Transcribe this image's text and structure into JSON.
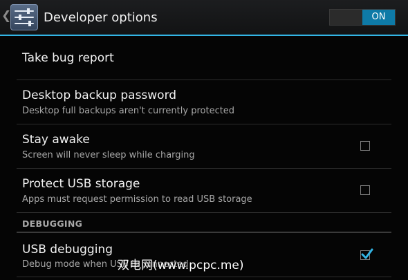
{
  "actionbar": {
    "title": "Developer options",
    "toggle_label": "ON",
    "accent": "#33b5e5"
  },
  "items": [
    {
      "title": "Take bug report"
    },
    {
      "title": "Desktop backup password",
      "summary": "Desktop full backups aren't currently protected"
    },
    {
      "title": "Stay awake",
      "summary": "Screen will never sleep while charging",
      "checked": false
    },
    {
      "title": "Protect USB storage",
      "summary": "Apps must request permission to read USB storage",
      "checked": false
    }
  ],
  "section": {
    "header": "DEBUGGING"
  },
  "debug_items": [
    {
      "title": "USB debugging",
      "summary": "Debug mode when USB is connected",
      "checked": true
    }
  ],
  "watermark": "双电网(www.pcpc.me)",
  "icons": {
    "up": "chevron-left-icon",
    "app": "settings-sliders-icon",
    "check": "checkmark-icon"
  }
}
